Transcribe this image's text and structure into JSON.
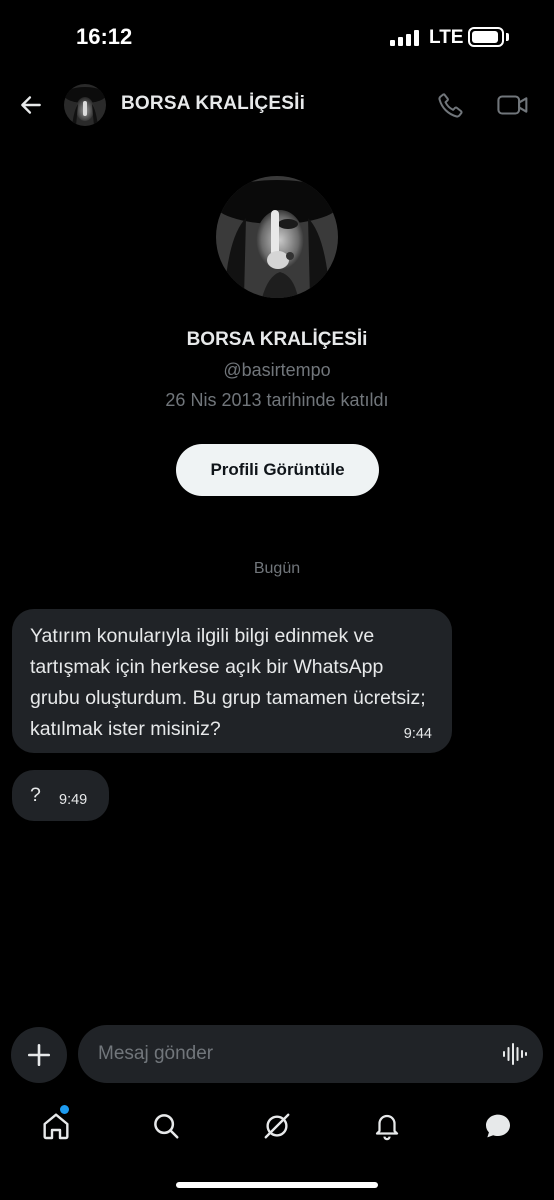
{
  "status_bar": {
    "time": "16:12",
    "network": "LTE"
  },
  "header": {
    "title": "BORSA KRALİÇESİi",
    "icons": [
      "back-arrow-icon",
      "phone-icon",
      "video-camera-icon"
    ]
  },
  "profile": {
    "name": "BORSA KRALİÇESİi",
    "handle": "@basirtempo",
    "joined": "26 Nis 2013 tarihinde katıldı",
    "view_button": "Profili Görüntüle"
  },
  "conversation": {
    "date_separator": "Bugün",
    "messages": [
      {
        "text": "Yatırım konularıyla ilgili bilgi edinmek ve tartışmak için herkese açık bir WhatsApp grubu oluşturdum. Bu grup tamamen ücretsiz; katılmak ister misiniz?",
        "time": "9:44"
      },
      {
        "text": "?",
        "time": "9:49"
      }
    ]
  },
  "composer": {
    "placeholder": "Mesaj gönder",
    "value": ""
  },
  "tab_bar": {
    "items": [
      "home-icon",
      "search-icon",
      "grok-icon",
      "notifications-icon",
      "messages-icon"
    ],
    "accent_color": "#1d9bf0"
  },
  "colors": {
    "background": "#000000",
    "bubble": "#202327",
    "secondary_text": "#71767b",
    "primary_text": "#e7e9ea"
  }
}
